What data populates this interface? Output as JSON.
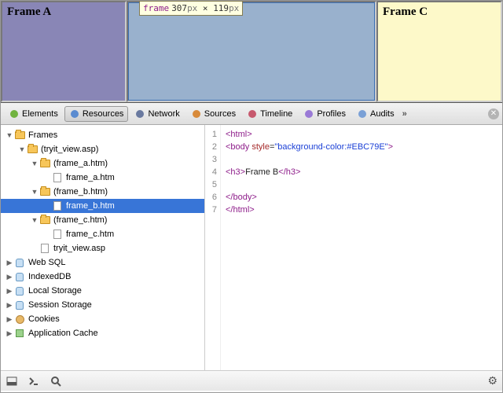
{
  "preview": {
    "frameA": "Frame A",
    "frameC": "Frame C",
    "tooltip": {
      "key": "frame",
      "w": "307",
      "h": "119",
      "unit": "px",
      "sep": " × "
    }
  },
  "toolbar": {
    "items": [
      {
        "label": "Elements",
        "icon": "elements-icon",
        "sel": false,
        "color": "#71b340"
      },
      {
        "label": "Resources",
        "icon": "resources-icon",
        "sel": true,
        "color": "#5a8bd0"
      },
      {
        "label": "Network",
        "icon": "network-icon",
        "sel": false,
        "color": "#6a7aa0"
      },
      {
        "label": "Sources",
        "icon": "sources-icon",
        "sel": false,
        "color": "#d88a3a"
      },
      {
        "label": "Timeline",
        "icon": "timeline-icon",
        "sel": false,
        "color": "#c7596e"
      },
      {
        "label": "Profiles",
        "icon": "profiles-icon",
        "sel": false,
        "color": "#9a7ad6"
      },
      {
        "label": "Audits",
        "icon": "audits-icon",
        "sel": false,
        "color": "#7aa0d6"
      }
    ],
    "overflow": "»"
  },
  "tree": [
    {
      "d": 0,
      "tw": "▼",
      "ic": "folder",
      "t": "Frames"
    },
    {
      "d": 1,
      "tw": "▼",
      "ic": "folder",
      "t": "(tryit_view.asp)"
    },
    {
      "d": 2,
      "tw": "▼",
      "ic": "folder",
      "t": "(frame_a.htm)"
    },
    {
      "d": 3,
      "tw": "",
      "ic": "file",
      "t": "frame_a.htm"
    },
    {
      "d": 2,
      "tw": "▼",
      "ic": "folder",
      "t": "(frame_b.htm)"
    },
    {
      "d": 3,
      "tw": "",
      "ic": "file",
      "t": "frame_b.htm",
      "sel": true
    },
    {
      "d": 2,
      "tw": "▼",
      "ic": "folder",
      "t": "(frame_c.htm)"
    },
    {
      "d": 3,
      "tw": "",
      "ic": "file",
      "t": "frame_c.htm"
    },
    {
      "d": 2,
      "tw": "",
      "ic": "file",
      "t": "tryit_view.asp"
    },
    {
      "d": 0,
      "tw": "▶",
      "ic": "db",
      "t": "Web SQL"
    },
    {
      "d": 0,
      "tw": "▶",
      "ic": "db",
      "t": "IndexedDB"
    },
    {
      "d": 0,
      "tw": "▶",
      "ic": "db",
      "t": "Local Storage"
    },
    {
      "d": 0,
      "tw": "▶",
      "ic": "db",
      "t": "Session Storage"
    },
    {
      "d": 0,
      "tw": "▶",
      "ic": "cookie",
      "t": "Cookies"
    },
    {
      "d": 0,
      "tw": "▶",
      "ic": "cache",
      "t": "Application Cache"
    }
  ],
  "code": {
    "lines": [
      "1",
      "2",
      "3",
      "4",
      "5",
      "6",
      "7"
    ],
    "l1a": "<html>",
    "l2a": "<body",
    "l2b": " style",
    "l2c": "=",
    "l2d": "\"background-color:#EBC79E\"",
    "l2e": ">",
    "l4a": "<h3>",
    "l4b": "Frame B",
    "l4c": "</h3>",
    "l6": "</body>",
    "l7": "</html>"
  }
}
